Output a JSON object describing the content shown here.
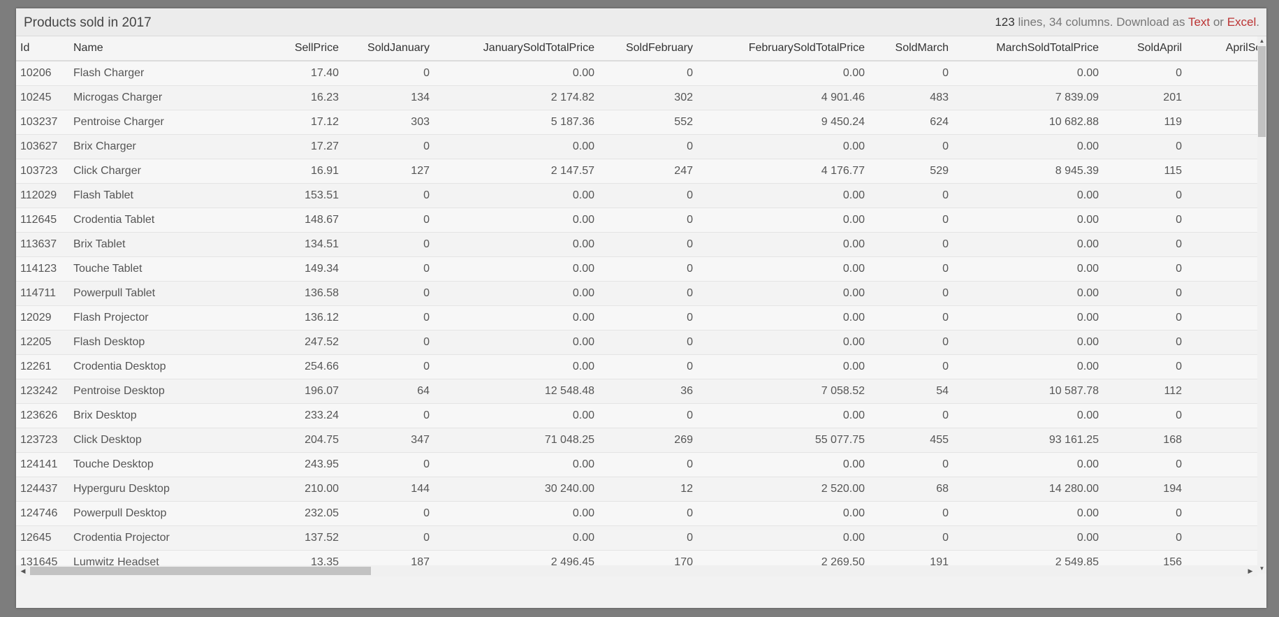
{
  "header": {
    "title": "Products sold in 2017",
    "line_count": "123",
    "info_rest": " lines, 34 columns. Download as ",
    "text_link": "Text",
    "or": " or ",
    "excel_link": "Excel",
    "period": "."
  },
  "columns": [
    "Id",
    "Name",
    "SellPrice",
    "SoldJanuary",
    "JanuarySoldTotalPrice",
    "SoldFebruary",
    "FebruarySoldTotalPrice",
    "SoldMarch",
    "MarchSoldTotalPrice",
    "SoldApril",
    "AprilSoldTotalPrice"
  ],
  "rows": [
    [
      "10206",
      "Flash Charger",
      "17.40",
      "0",
      "0.00",
      "0",
      "0.00",
      "0",
      "0.00",
      "0",
      ""
    ],
    [
      "10245",
      "Microgas Charger",
      "16.23",
      "134",
      "2 174.82",
      "302",
      "4 901.46",
      "483",
      "7 839.09",
      "201",
      ""
    ],
    [
      "103237",
      "Pentroise Charger",
      "17.12",
      "303",
      "5 187.36",
      "552",
      "9 450.24",
      "624",
      "10 682.88",
      "119",
      ""
    ],
    [
      "103627",
      "Brix Charger",
      "17.27",
      "0",
      "0.00",
      "0",
      "0.00",
      "0",
      "0.00",
      "0",
      ""
    ],
    [
      "103723",
      "Click Charger",
      "16.91",
      "127",
      "2 147.57",
      "247",
      "4 176.77",
      "529",
      "8 945.39",
      "115",
      ""
    ],
    [
      "112029",
      "Flash Tablet",
      "153.51",
      "0",
      "0.00",
      "0",
      "0.00",
      "0",
      "0.00",
      "0",
      ""
    ],
    [
      "112645",
      "Crodentia Tablet",
      "148.67",
      "0",
      "0.00",
      "0",
      "0.00",
      "0",
      "0.00",
      "0",
      ""
    ],
    [
      "113637",
      "Brix Tablet",
      "134.51",
      "0",
      "0.00",
      "0",
      "0.00",
      "0",
      "0.00",
      "0",
      ""
    ],
    [
      "114123",
      "Touche Tablet",
      "149.34",
      "0",
      "0.00",
      "0",
      "0.00",
      "0",
      "0.00",
      "0",
      ""
    ],
    [
      "114711",
      "Powerpull Tablet",
      "136.58",
      "0",
      "0.00",
      "0",
      "0.00",
      "0",
      "0.00",
      "0",
      ""
    ],
    [
      "12029",
      "Flash Projector",
      "136.12",
      "0",
      "0.00",
      "0",
      "0.00",
      "0",
      "0.00",
      "0",
      ""
    ],
    [
      "12205",
      "Flash Desktop",
      "247.52",
      "0",
      "0.00",
      "0",
      "0.00",
      "0",
      "0.00",
      "0",
      ""
    ],
    [
      "12261",
      "Crodentia Desktop",
      "254.66",
      "0",
      "0.00",
      "0",
      "0.00",
      "0",
      "0.00",
      "0",
      ""
    ],
    [
      "123242",
      "Pentroise Desktop",
      "196.07",
      "64",
      "12 548.48",
      "36",
      "7 058.52",
      "54",
      "10 587.78",
      "112",
      ""
    ],
    [
      "123626",
      "Brix Desktop",
      "233.24",
      "0",
      "0.00",
      "0",
      "0.00",
      "0",
      "0.00",
      "0",
      ""
    ],
    [
      "123723",
      "Click Desktop",
      "204.75",
      "347",
      "71 048.25",
      "269",
      "55 077.75",
      "455",
      "93 161.25",
      "168",
      ""
    ],
    [
      "124141",
      "Touche Desktop",
      "243.95",
      "0",
      "0.00",
      "0",
      "0.00",
      "0",
      "0.00",
      "0",
      ""
    ],
    [
      "124437",
      "Hyperguru Desktop",
      "210.00",
      "144",
      "30 240.00",
      "12",
      "2 520.00",
      "68",
      "14 280.00",
      "194",
      ""
    ],
    [
      "124746",
      "Powerpull Desktop",
      "232.05",
      "0",
      "0.00",
      "0",
      "0.00",
      "0",
      "0.00",
      "0",
      ""
    ],
    [
      "12645",
      "Crodentia Projector",
      "137.52",
      "0",
      "0.00",
      "0",
      "0.00",
      "0",
      "0.00",
      "0",
      ""
    ],
    [
      "131645",
      "Lumwitz Headset",
      "13.35",
      "187",
      "2 496.45",
      "170",
      "2 269.50",
      "191",
      "2 549.85",
      "156",
      ""
    ]
  ]
}
